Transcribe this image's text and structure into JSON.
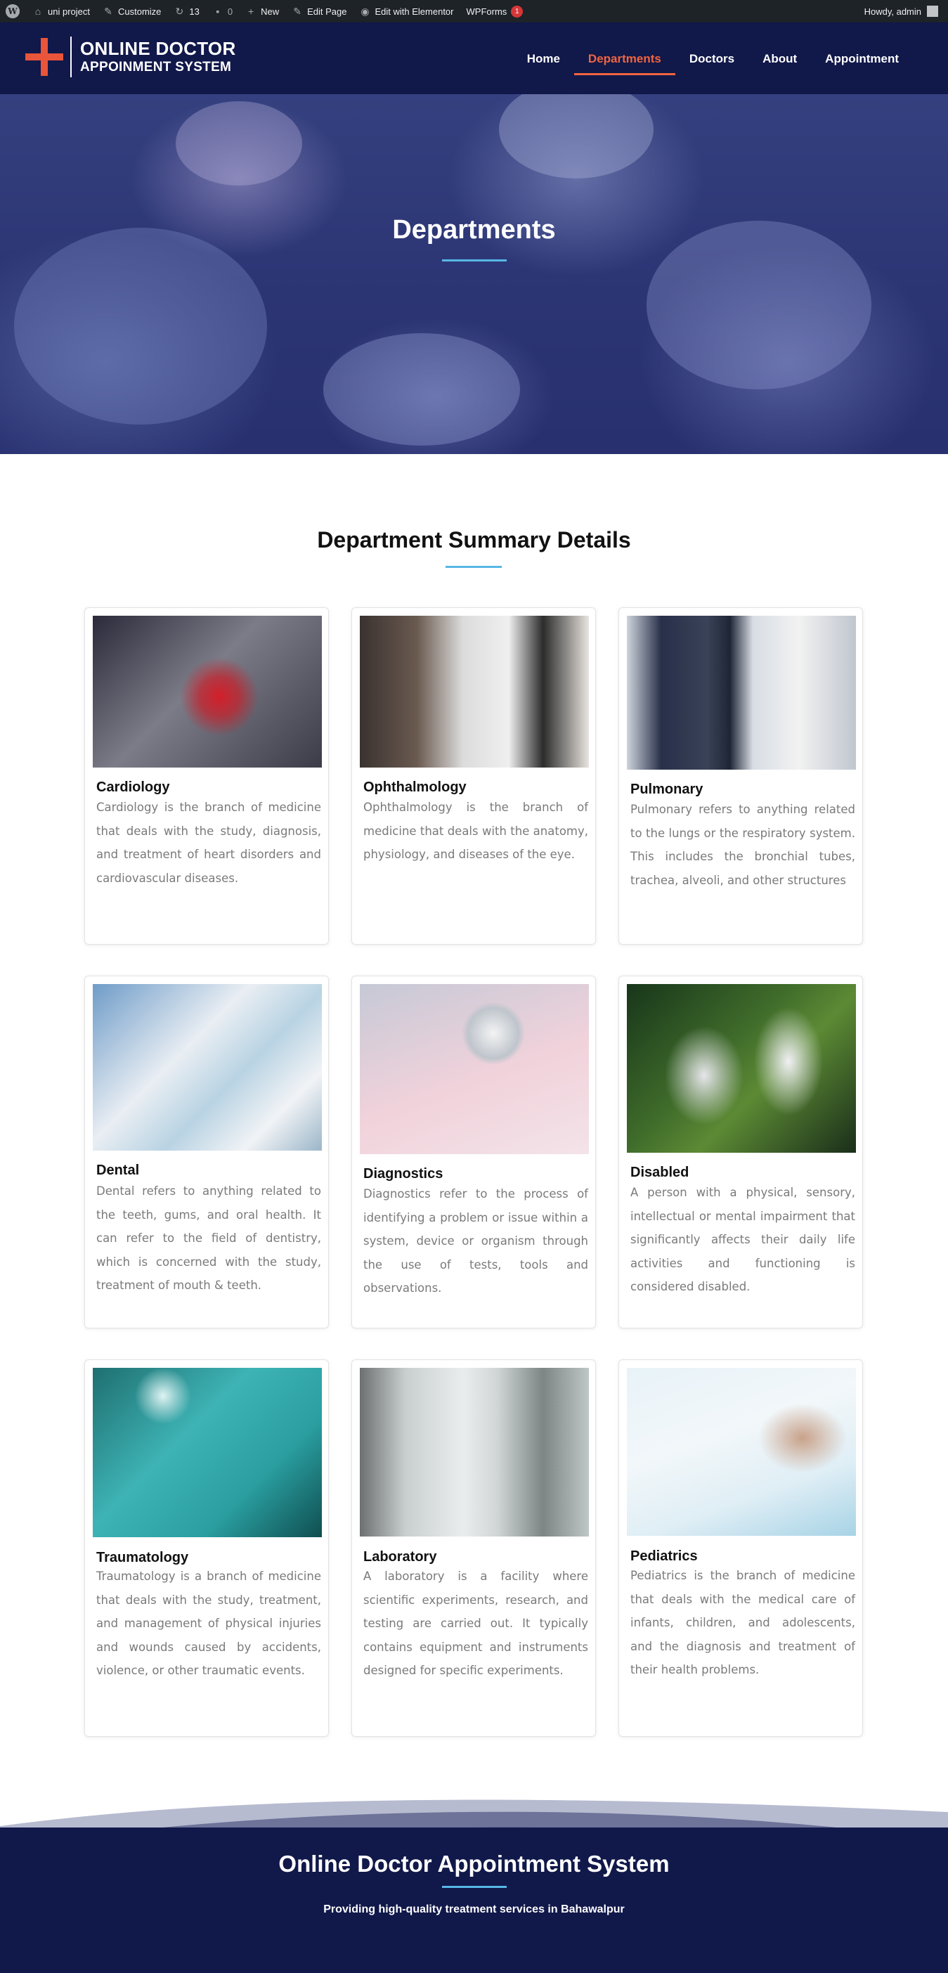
{
  "admin_bar": {
    "site_name": "uni project",
    "customize": "Customize",
    "updates_count": "13",
    "comments_count": "0",
    "new_label": "New",
    "edit_page": "Edit Page",
    "edit_elementor": "Edit with Elementor",
    "wpforms": "WPForms",
    "wpforms_badge": "1",
    "greeting": "Howdy, admin"
  },
  "header": {
    "logo_line1": "ONLINE DOCTOR",
    "logo_line2": "APPOINMENT SYSTEM",
    "nav": [
      {
        "label": "Home",
        "active": false
      },
      {
        "label": "Departments",
        "active": true
      },
      {
        "label": "Doctors",
        "active": false
      },
      {
        "label": "About",
        "active": false
      },
      {
        "label": "Appointment",
        "active": false
      }
    ],
    "accent_color": "#f0653f",
    "background_color": "#11184a"
  },
  "hero": {
    "title": "Departments"
  },
  "section": {
    "title": "Department Summary Details"
  },
  "departments": [
    {
      "title": "Cardiology",
      "text": "Cardiology is the branch of medicine that deals with the study, diagnosis, and treatment of heart disorders and cardiovascular diseases.",
      "image": "heart-pain-photo"
    },
    {
      "title": "Ophthalmology",
      "text": "Ophthalmology is the branch of medicine that deals with the anatomy, physiology, and diseases of the eye.",
      "image": "eye-exam-photo"
    },
    {
      "title": "Pulmonary",
      "text": "Pulmonary refers to anything related to the lungs or the respiratory system. This includes the bronchial tubes, trachea, alveoli, and other structures",
      "image": "lung-xray-photo"
    },
    {
      "title": "Dental",
      "text": "Dental refers to anything related to the teeth, gums, and oral health. It can refer to the field of dentistry, which is concerned with the study, treatment of mouth & teeth.",
      "image": "dentist-photo"
    },
    {
      "title": "Diagnostics",
      "text": "Diagnostics refer to the process of identifying a problem or issue within a system, device or organism through the use of tests, tools and observations.",
      "image": "stethoscope-photo"
    },
    {
      "title": "Disabled",
      "text": "A person with a physical, sensory, intellectual or mental impairment that significantly affects their daily life activities and functioning is considered disabled.",
      "image": "wheelchair-photo"
    },
    {
      "title": "Traumatology",
      "text": "Traumatology is a branch of medicine that deals with the study, treatment, and management of physical injuries and wounds caused by accidents, violence, or other traumatic events.",
      "image": "surgery-photo"
    },
    {
      "title": "Laboratory",
      "text": "A laboratory is a facility where scientific experiments, research, and testing are carried out. It typically contains equipment and instruments designed for specific experiments.",
      "image": "lab-photo"
    },
    {
      "title": "Pediatrics",
      "text": "Pediatrics is the branch of medicine that deals with the medical care of infants, children, and adolescents, and the diagnosis and treatment of their health problems.",
      "image": "child-patient-photo"
    }
  ],
  "footer": {
    "title": "Online Doctor Appointment System",
    "subtitle": "Providing high-quality treatment services in Bahawalpur"
  }
}
